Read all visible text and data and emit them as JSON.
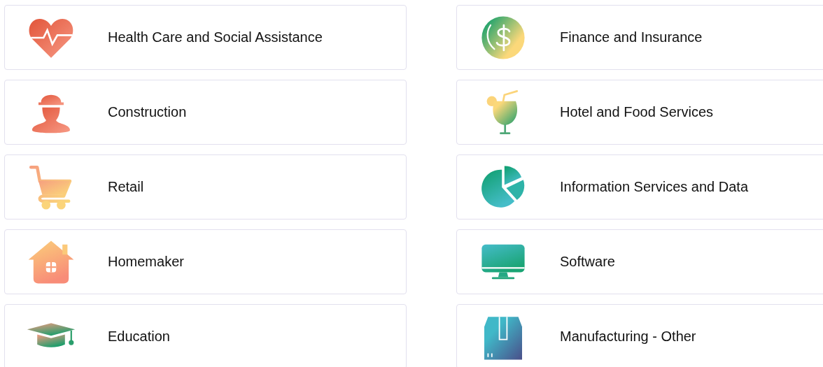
{
  "industries": [
    {
      "label": "Health Care and Social Assistance",
      "kind": "heart"
    },
    {
      "label": "Finance and Insurance",
      "kind": "coin"
    },
    {
      "label": "Construction",
      "kind": "worker"
    },
    {
      "label": "Hotel and Food Services",
      "kind": "drink"
    },
    {
      "label": "Retail",
      "kind": "cart"
    },
    {
      "label": "Information Services and Data",
      "kind": "pie"
    },
    {
      "label": "Homemaker",
      "kind": "house"
    },
    {
      "label": "Software",
      "kind": "monitor"
    },
    {
      "label": "Education",
      "kind": "cap"
    },
    {
      "label": "Manufacturing - Other",
      "kind": "box"
    }
  ]
}
